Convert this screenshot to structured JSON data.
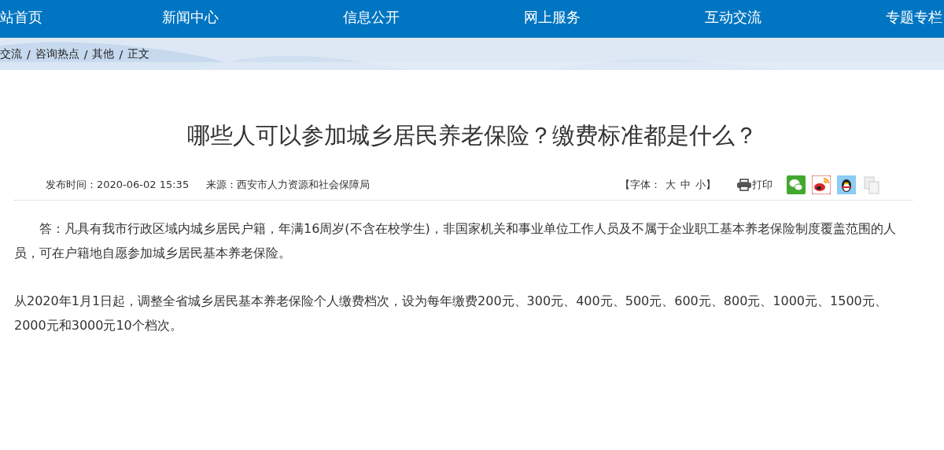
{
  "nav": [
    {
      "label": "站首页",
      "selected": false
    },
    {
      "label": "新闻中心",
      "selected": false
    },
    {
      "label": "信息公开",
      "selected": false
    },
    {
      "label": "网上服务",
      "selected": false
    },
    {
      "label": "互动交流",
      "selected": false
    },
    {
      "label": "专题专栏",
      "selected": false
    }
  ],
  "breadcrumb": [
    "交流",
    "咨询热点",
    "其他",
    "正文"
  ],
  "breadcrumb_separator": "/",
  "article": {
    "title": "哪些人可以参加城乡居民养老保险？缴费标准都是什么？",
    "published": "发布时间：2020-06-02 15:35",
    "source": "来源：西安市人力资源和社会保障局",
    "font_size": {
      "label": "【字体：",
      "options": [
        "大",
        "中",
        "小"
      ],
      "end": "】"
    },
    "print": "打印",
    "share": [
      {
        "kind": "wechat"
      },
      {
        "kind": "weibo"
      },
      {
        "kind": "qq"
      },
      {
        "kind": "copy"
      }
    ],
    "paragraphs": [
      "答：凡具有我市行政区域内城乡居民户籍，年满16周岁(不含在校学生)，非国家机关和事业单位工作人员及不属于企业职工基本养老保险制度覆盖范围的人员，可在户籍地自愿参加城乡居民基本养老保险。",
      "从2020年1月1日起，调整全省城乡居民基本养老保险个人缴费档次，设为每年缴费200元、300元、400元、500元、600元、800元、1000元、1500元、2000元和3000元10个档次。"
    ]
  }
}
